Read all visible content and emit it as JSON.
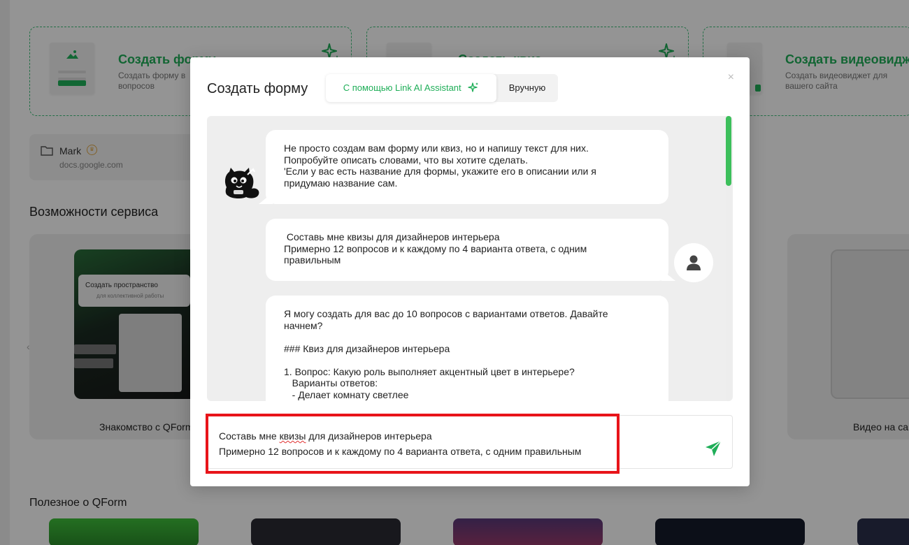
{
  "background": {
    "create_cards": [
      {
        "title": "Создать форму",
        "desc": "Создать форму в ... вопросов",
        "desc_line1": "Создать форму в",
        "desc_line2": "вопросов"
      },
      {
        "title": "Создать квиз",
        "desc": ""
      },
      {
        "title": "Создать видеовиджет",
        "desc_line1": "Создать видеовиджет для",
        "desc_line2": "вашего сайта"
      }
    ],
    "folder": {
      "name": "Mark",
      "source": "docs.google.com"
    },
    "features_title": "Возможности сервиса",
    "feature_cards": [
      {
        "label": "Знакомство с QForm",
        "inner_button": "Создать пространство",
        "inner_sub": "для коллективной работы"
      },
      {
        "label": "Видео на сайт"
      }
    ],
    "useful_title": "Полезное о QForm"
  },
  "modal": {
    "title": "Создать форму",
    "tabs": [
      {
        "label": "С помощью Link AI Assistant",
        "active": true
      },
      {
        "label": "Вручную",
        "active": false
      }
    ],
    "close_glyph": "×",
    "messages": [
      {
        "role": "bot",
        "text": "Не просто создам вам форму или квиз, но и напишу текст для них.\nПопробуйте описать словами, что вы хотите сделать.\n'Если у вас есть название для формы, укажите его в описании или я\nпридумаю название сам."
      },
      {
        "role": "user",
        "text": " Составь мне квизы для дизайнеров интерьера\nПримерно 12 вопросов и к каждому по 4 варианта ответа, с одним\nправильным"
      },
      {
        "role": "bot",
        "text": "Я могу создать для вас до 10 вопросов с вариантами ответов. Давайте\nначнем?\n\n### Квиз для дизайнеров интерьера\n\n1. Вопрос: Какую роль выполняет акцентный цвет в интерьере?\n   Варианты ответов:\n   - Делает комнату светлее"
      }
    ],
    "composer": {
      "line1_before": "Составь мне ",
      "line1_misspelled": "квизы",
      "line1_after": " для дизайнеров интерьера",
      "line2": "Примерно 12 вопросов и к каждому по 4 варианта ответа, с одним правильным"
    },
    "icons": {
      "send": "send-icon",
      "tab_ai": "sparkle-icon",
      "user": "user-icon",
      "bot": "cat-avatar-icon"
    }
  },
  "colors": {
    "accent": "#1fae58",
    "highlight": "#e8141a",
    "scroll": "#3cbf5b"
  }
}
